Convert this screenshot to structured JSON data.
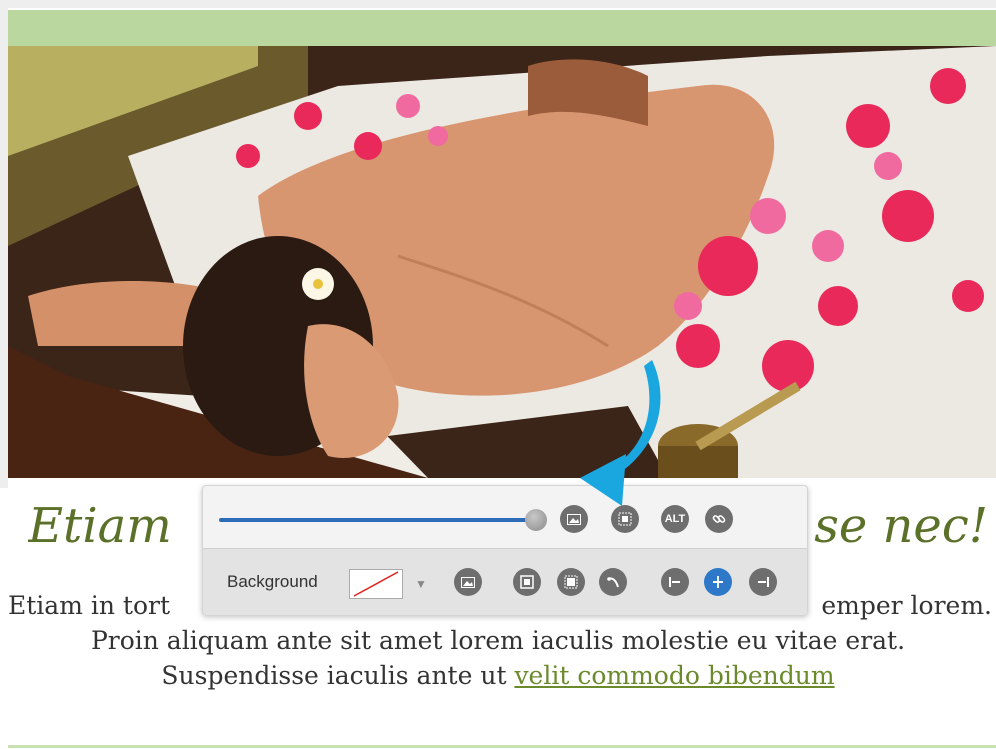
{
  "heading": {
    "left_text": "Etiam",
    "right_text": "se nec!"
  },
  "body": {
    "line1_left": "Etiam in tort",
    "line1_right": "emper lorem.",
    "line2": "Proin aliquam ante sit amet lorem iaculis molestie eu vitae erat.",
    "line3_prefix": "Suspendisse iaculis ante ut ",
    "link_text": "velit commodo bibendum"
  },
  "toolbar": {
    "size_slider_value": 1.0,
    "alt_label": "ALT",
    "background_label": "Background",
    "background_swatch": "none",
    "icons_row1": [
      "image-icon",
      "fit-frame-icon",
      "alt-text-button",
      "link-icon"
    ],
    "icons_row2": [
      "background-image-icon",
      "border-inner-icon",
      "border-outer-icon",
      "curve-icon",
      "align-left-icon",
      "align-center-icon",
      "align-right-icon"
    ],
    "active_alignment": "center"
  },
  "colors": {
    "green_bar": "#bad7a0",
    "heading": "#5b7028",
    "link": "#6b8a2c",
    "accent_blue": "#2d78c8",
    "arrow": "#1aa7e0"
  }
}
